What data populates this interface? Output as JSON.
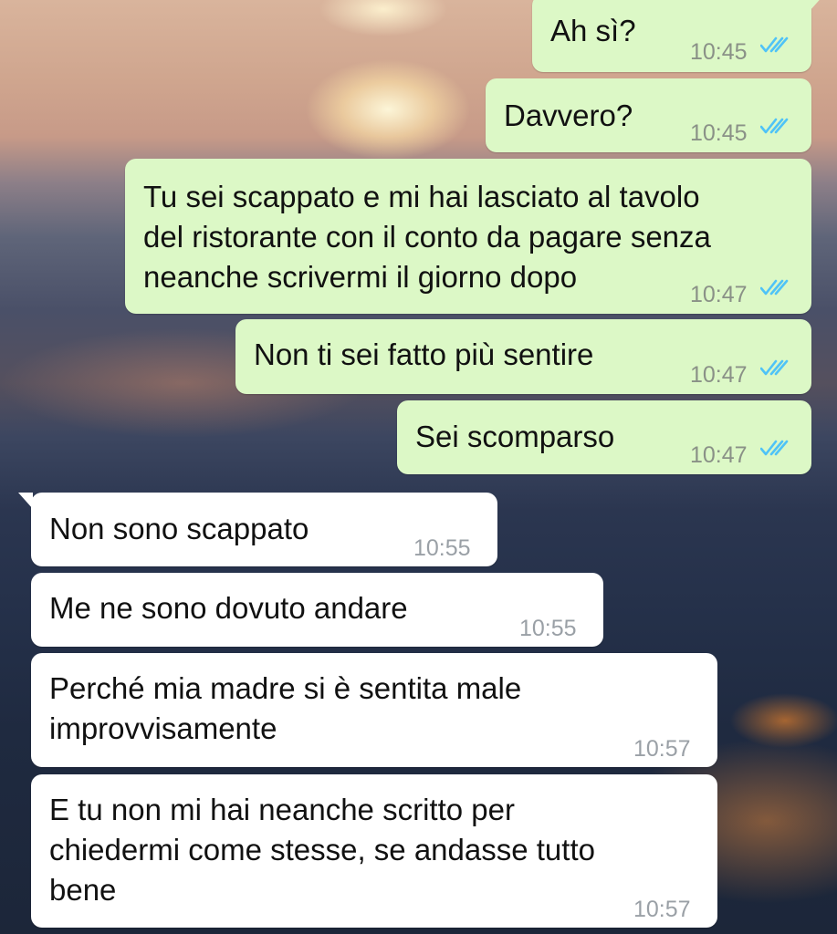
{
  "messages": [
    {
      "direction": "outgoing",
      "lines": [
        "Ah sì?"
      ],
      "time": "10:45",
      "status": "read",
      "status_icon": "double-check-icon",
      "status_color": "#4fc3f7"
    },
    {
      "direction": "outgoing",
      "lines": [
        "Davvero?"
      ],
      "time": "10:45",
      "status": "read",
      "status_icon": "double-check-icon",
      "status_color": "#4fc3f7"
    },
    {
      "direction": "outgoing",
      "lines": [
        "Tu sei scappato e mi hai lasciato al tavolo",
        "del ristorante con il conto da pagare senza",
        "neanche scrivermi il giorno dopo"
      ],
      "time": "10:47",
      "status": "read",
      "status_icon": "double-check-icon",
      "status_color": "#4fc3f7"
    },
    {
      "direction": "outgoing",
      "lines": [
        "Non ti sei fatto più sentire"
      ],
      "time": "10:47",
      "status": "read",
      "status_icon": "double-check-icon",
      "status_color": "#4fc3f7"
    },
    {
      "direction": "outgoing",
      "lines": [
        "Sei scomparso"
      ],
      "time": "10:47",
      "status": "read",
      "status_icon": "double-check-icon",
      "status_color": "#4fc3f7"
    },
    {
      "direction": "incoming",
      "lines": [
        "Non sono scappato"
      ],
      "time": "10:55"
    },
    {
      "direction": "incoming",
      "lines": [
        "Me ne sono dovuto andare"
      ],
      "time": "10:55"
    },
    {
      "direction": "incoming",
      "lines": [
        "Perché mia madre si è sentita male",
        "improvvisamente"
      ],
      "time": "10:57"
    },
    {
      "direction": "incoming",
      "lines": [
        "E tu non mi hai neanche scritto per",
        "chiedermi come stesse, se andasse tutto",
        "bene"
      ],
      "time": "10:57"
    }
  ],
  "colors": {
    "outgoing_bubble": "#dcf8c6",
    "incoming_bubble": "#ffffff",
    "read_ticks": "#4fc3f7"
  }
}
